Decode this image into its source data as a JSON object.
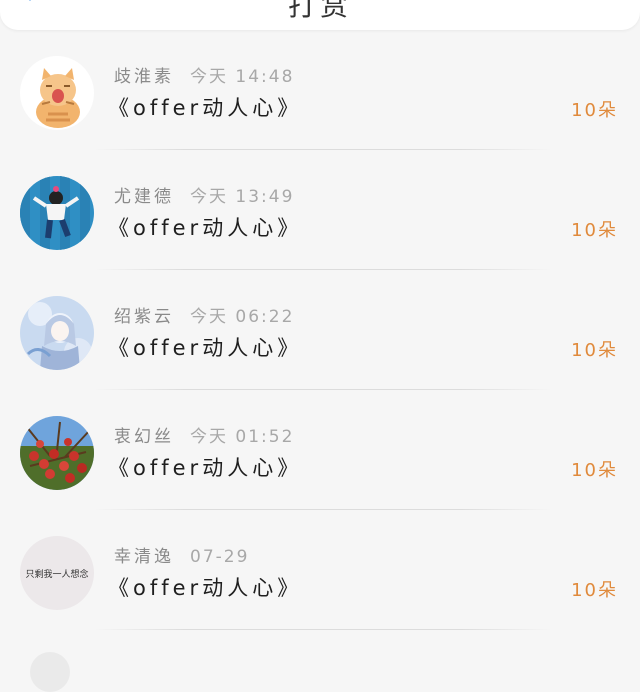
{
  "header": {
    "title": "打赏"
  },
  "records": [
    {
      "name": "歧淮素",
      "time": "今天 14:48",
      "title": "《offer动人心》",
      "amount": "10朵",
      "avatar": "cat"
    },
    {
      "name": "尤建德",
      "time": "今天 13:49",
      "title": "《offer动人心》",
      "amount": "10朵",
      "avatar": "girl-blue-wall"
    },
    {
      "name": "绍紫云",
      "time": "今天 06:22",
      "title": "《offer动人心》",
      "amount": "10朵",
      "avatar": "anime-girl"
    },
    {
      "name": "衷幻丝",
      "time": "今天 01:52",
      "title": "《offer动人心》",
      "amount": "10朵",
      "avatar": "red-berries"
    },
    {
      "name": "幸清逸",
      "time": "07-29",
      "title": "《offer动人心》",
      "amount": "10朵",
      "avatar": "handwriting",
      "avatar_text": "只剩我一人想念"
    }
  ],
  "colors": {
    "amount": "#e08a3c",
    "back_icon": "#3a8ee6"
  }
}
